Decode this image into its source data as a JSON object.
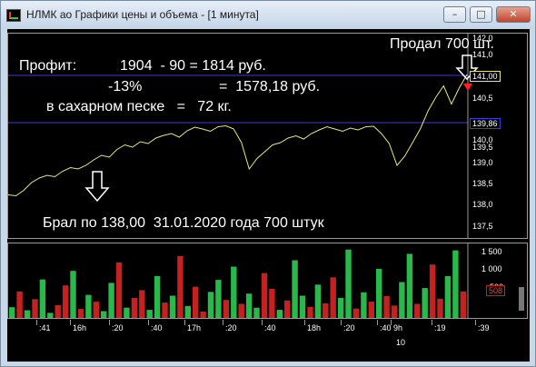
{
  "window": {
    "title": "НЛМК ао Графики цены и объема - [1 минута]",
    "controls": [
      "minimize",
      "maximize",
      "close"
    ]
  },
  "annotations": {
    "sold": "Продал 700 шт.",
    "profit_label": "Профит:",
    "profit_calc": "1904  - 90 = 1814 руб.",
    "percent": "-13%",
    "percent_value": "=  1578,18 руб.",
    "sugar": "в сахарном песке   =   72 кг.",
    "bought": "Брал по 138,00  31.01.2020 года 700 штук"
  },
  "price_axis": {
    "ticks": [
      "142,0",
      "141,0",
      "140,5",
      "140,0",
      "139,5",
      "139,0",
      "138,5",
      "138,0",
      "137,5"
    ],
    "tag_high": "141,00",
    "tag_low": "139,86"
  },
  "volume_axis": {
    "ticks": [
      "1 500",
      "1 000",
      "500"
    ],
    "tag": "508"
  },
  "time_axis": {
    "ticks": [
      ":41",
      "16h",
      ":20",
      ":40",
      "17h",
      ":20",
      ":40",
      "18h",
      ":20",
      ":40",
      "9h",
      ":19",
      ":39"
    ],
    "day_label": "10"
  },
  "colors": {
    "price_line": "#e8e87a",
    "volume_up": "#29b84a",
    "volume_down": "#c42121",
    "guide_line": "#3b3bd6",
    "arrow_marker": "#ff2020"
  },
  "chart_data": {
    "type": "line",
    "series": [
      {
        "values": [
          138.45,
          138.43,
          138.55,
          138.72,
          138.82,
          138.88,
          138.85,
          138.97,
          139.05,
          139.02,
          139.1,
          139.22,
          139.32,
          139.28,
          139.45,
          139.55,
          139.5,
          139.62,
          139.58,
          139.7,
          139.76,
          139.8,
          139.72,
          139.86,
          139.94,
          139.9,
          139.85,
          139.95,
          139.97,
          139.9,
          139.6,
          139.02,
          139.25,
          139.4,
          139.55,
          139.6,
          139.7,
          139.75,
          139.68,
          139.8,
          139.88,
          139.95,
          139.9,
          139.85,
          139.92,
          139.88,
          139.95,
          139.96,
          139.8,
          139.58,
          139.1,
          139.3,
          139.6,
          139.9,
          140.3,
          140.6,
          140.85,
          140.45,
          140.8,
          141.1
        ]
      }
    ],
    "ylim": [
      137.5,
      142.0
    ]
  },
  "volume_data": {
    "ylim": [
      0,
      1700
    ],
    "values": [
      250,
      620,
      180,
      440,
      900,
      120,
      300,
      760,
      1100,
      210,
      540,
      380,
      160,
      820,
      1300,
      240,
      470,
      650,
      190,
      980,
      360,
      520,
      1450,
      280,
      730,
      150,
      610,
      890,
      420,
      1200,
      330,
      570,
      240,
      1050,
      680,
      190,
      410,
      1350,
      520,
      260,
      780,
      340,
      950,
      470,
      1600,
      220,
      600,
      380,
      1150,
      510,
      290,
      840,
      1500,
      330,
      700,
      1250,
      450,
      980,
      1580,
      620
    ],
    "directions": [
      1,
      0,
      1,
      0,
      1,
      1,
      0,
      0,
      1,
      0,
      1,
      0,
      1,
      1,
      0,
      1,
      0,
      0,
      1,
      1,
      0,
      1,
      0,
      1,
      0,
      0,
      1,
      1,
      0,
      1,
      0,
      1,
      1,
      0,
      0,
      1,
      0,
      1,
      1,
      0,
      1,
      0,
      0,
      1,
      1,
      0,
      1,
      0,
      1,
      0,
      0,
      1,
      1,
      0,
      1,
      0,
      0,
      1,
      1,
      0
    ]
  }
}
